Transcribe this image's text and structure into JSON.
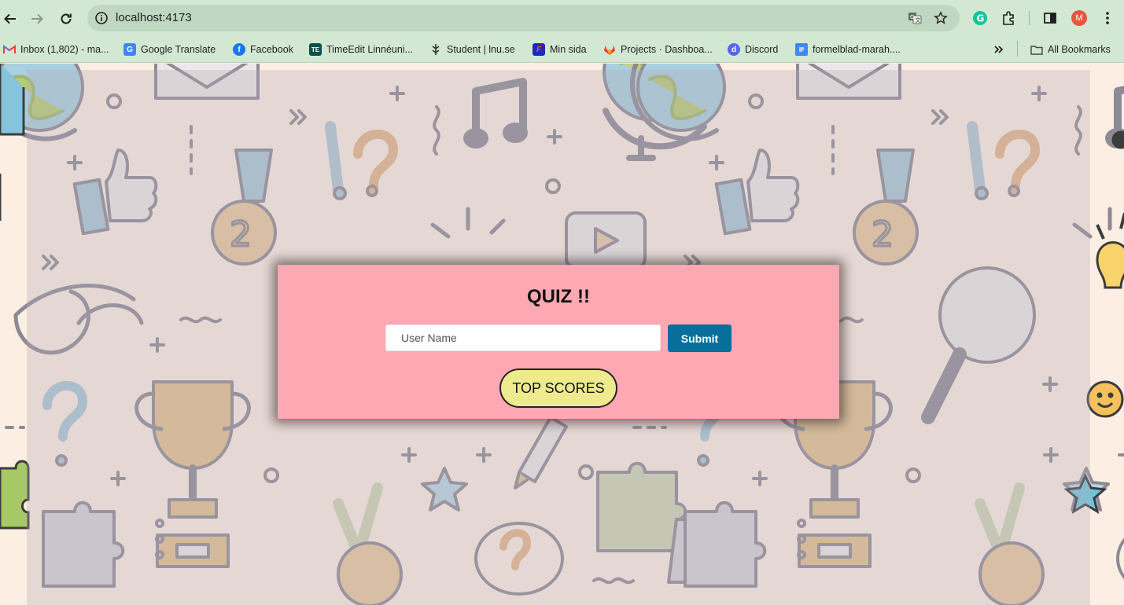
{
  "browser": {
    "url": "localhost:4173",
    "profile_initial": "M",
    "bookmarks": [
      {
        "label": "Inbox (1,802) - ma...",
        "icon": "gmail-icon"
      },
      {
        "label": "Google Translate",
        "icon": "google-translate-icon"
      },
      {
        "label": "Facebook",
        "icon": "facebook-icon"
      },
      {
        "label": "TimeEdit Linnéuni...",
        "icon": "timeedit-icon"
      },
      {
        "label": "Student | lnu.se",
        "icon": "lnu-icon"
      },
      {
        "label": "Min sida",
        "icon": "minsida-icon"
      },
      {
        "label": "Projects · Dashboa...",
        "icon": "gitlab-icon"
      },
      {
        "label": "Discord",
        "icon": "discord-icon"
      },
      {
        "label": "formelblad-marah....",
        "icon": "google-docs-icon"
      }
    ],
    "all_bookmarks_label": "All Bookmarks",
    "colors": {
      "chrome": "#d3e8d2",
      "omnibox": "#c0d8c2"
    }
  },
  "quiz": {
    "title": "QUIZ !!",
    "username_placeholder": "User Name",
    "submit_label": "Submit",
    "top_scores_label": "TOP SCORES",
    "colors": {
      "card": "#fea8b4",
      "submit": "#066f9c",
      "top_scores": "#eeeb8e"
    }
  }
}
